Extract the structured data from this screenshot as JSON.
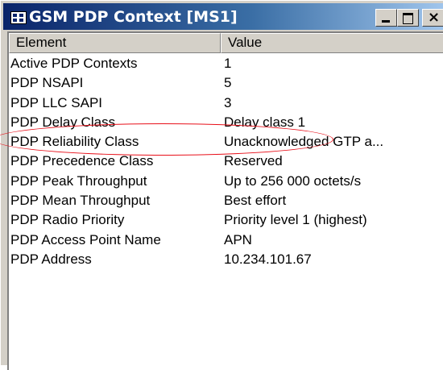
{
  "window": {
    "title": "GSM PDP Context [MS1]",
    "title_icon": "window-app-icon",
    "buttons": {
      "minimize": "minimize-icon",
      "maximize": "maximize-icon",
      "close": "close-icon"
    }
  },
  "list": {
    "columns": [
      "Element",
      "Value"
    ],
    "rows": [
      {
        "element": "Active PDP Contexts",
        "value": "1"
      },
      {
        "element": "PDP NSAPI",
        "value": "5"
      },
      {
        "element": "PDP LLC SAPI",
        "value": "3"
      },
      {
        "element": "PDP Delay Class",
        "value": "Delay class 1"
      },
      {
        "element": "PDP Reliability Class",
        "value": "Unacknowledged GTP a..."
      },
      {
        "element": "PDP Precedence Class",
        "value": "Reserved"
      },
      {
        "element": "PDP Peak Throughput",
        "value": "Up to 256 000 octets/s"
      },
      {
        "element": "PDP Mean Throughput",
        "value": "Best effort"
      },
      {
        "element": "PDP Radio Priority",
        "value": "Priority level 1 (highest)"
      },
      {
        "element": "PDP Access Point Name",
        "value": "APN"
      },
      {
        "element": "PDP Address",
        "value": "10.234.101.67"
      }
    ]
  },
  "colors": {
    "highlight_ellipse": "#e8101a",
    "titlebar": "#0a246a"
  }
}
